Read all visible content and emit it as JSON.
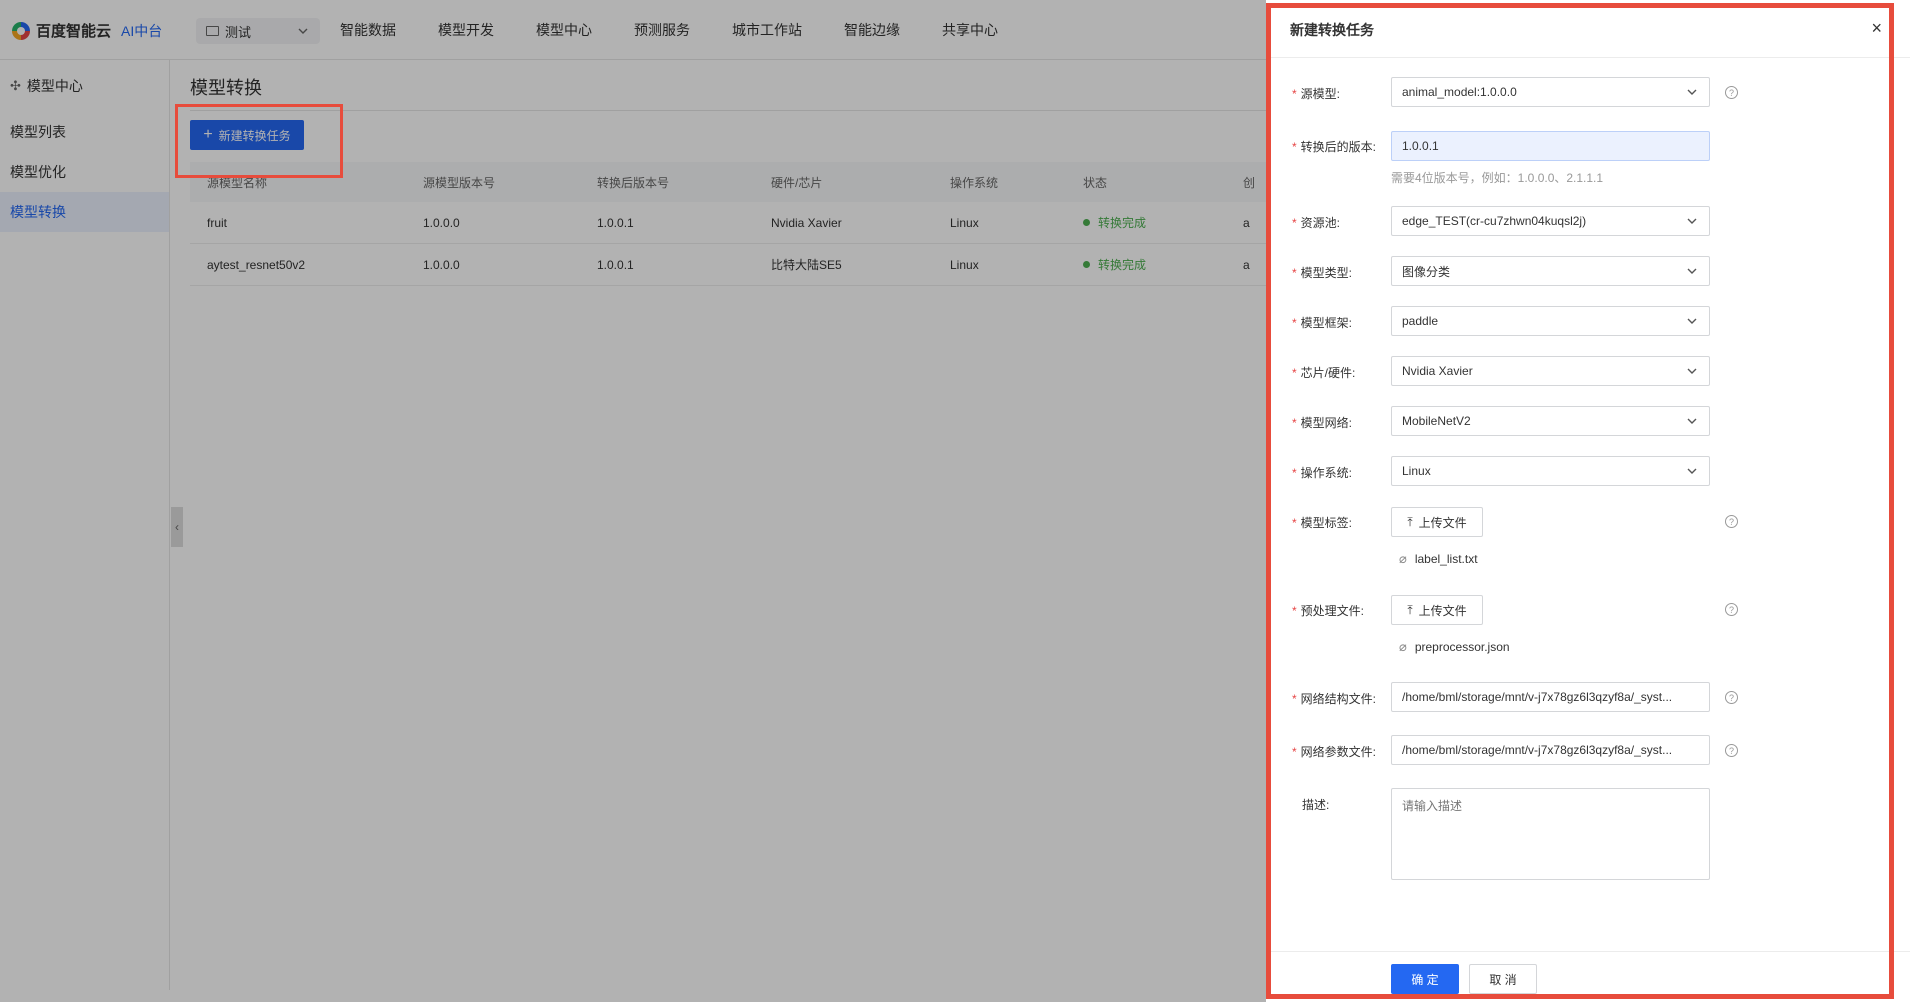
{
  "brand": {
    "name": "百度智能云",
    "sub": "AI中台"
  },
  "workspace": {
    "selected": "测试"
  },
  "nav": {
    "items": [
      "智能数据",
      "模型开发",
      "模型中心",
      "预测服务",
      "城市工作站",
      "智能边缘",
      "共享中心"
    ]
  },
  "sidebar": {
    "header": "模型中心",
    "items": [
      {
        "label": "模型列表",
        "active": false
      },
      {
        "label": "模型优化",
        "active": false
      },
      {
        "label": "模型转换",
        "active": true
      }
    ]
  },
  "main": {
    "title": "模型转换",
    "new_button": "新建转换任务",
    "table": {
      "columns": [
        "源模型名称",
        "源模型版本号",
        "转换后版本号",
        "硬件/芯片",
        "操作系统",
        "状态",
        "创"
      ],
      "rows": [
        {
          "name": "fruit",
          "src_version": "1.0.0.0",
          "dst_version": "1.0.0.1",
          "chip": "Nvidia Xavier",
          "os": "Linux",
          "status": "转换完成",
          "extra": "a"
        },
        {
          "name": "aytest_resnet50v2",
          "src_version": "1.0.0.0",
          "dst_version": "1.0.0.1",
          "chip": "比特大陆SE5",
          "os": "Linux",
          "status": "转换完成",
          "extra": "a"
        }
      ]
    }
  },
  "drawer": {
    "title": "新建转换任务",
    "close": "×",
    "source_model": {
      "label": "源模型:",
      "value": "animal_model:1.0.0.0"
    },
    "target_version": {
      "label": "转换后的版本:",
      "value": "1.0.0.1",
      "hint": "需要4位版本号，例如：1.0.0.0、2.1.1.1"
    },
    "resource_pool": {
      "label": "资源池:",
      "value": "edge_TEST(cr-cu7zhwn04kuqsl2j)"
    },
    "model_type": {
      "label": "模型类型:",
      "value": "图像分类"
    },
    "framework": {
      "label": "模型框架:",
      "value": "paddle"
    },
    "chip": {
      "label": "芯片/硬件:",
      "value": "Nvidia Xavier"
    },
    "network": {
      "label": "模型网络:",
      "value": "MobileNetV2"
    },
    "os": {
      "label": "操作系统:",
      "value": "Linux"
    },
    "label_file": {
      "label": "模型标签:",
      "button": "上传文件",
      "file": "label_list.txt"
    },
    "preprocess_file": {
      "label": "预处理文件:",
      "button": "上传文件",
      "file": "preprocessor.json"
    },
    "net_structure": {
      "label": "网络结构文件:",
      "value": "/home/bml/storage/mnt/v-j7x78gz6l3qzyf8a/_syst..."
    },
    "net_params": {
      "label": "网络参数文件:",
      "value": "/home/bml/storage/mnt/v-j7x78gz6l3qzyf8a/_syst..."
    },
    "description": {
      "label": "描述:",
      "placeholder": "请输入描述"
    },
    "ok": "确 定",
    "cancel": "取 消"
  },
  "colors": {
    "primary": "#2468f2",
    "success": "#4caf50",
    "required": "#e64545",
    "annotation": "#e74c3c"
  }
}
